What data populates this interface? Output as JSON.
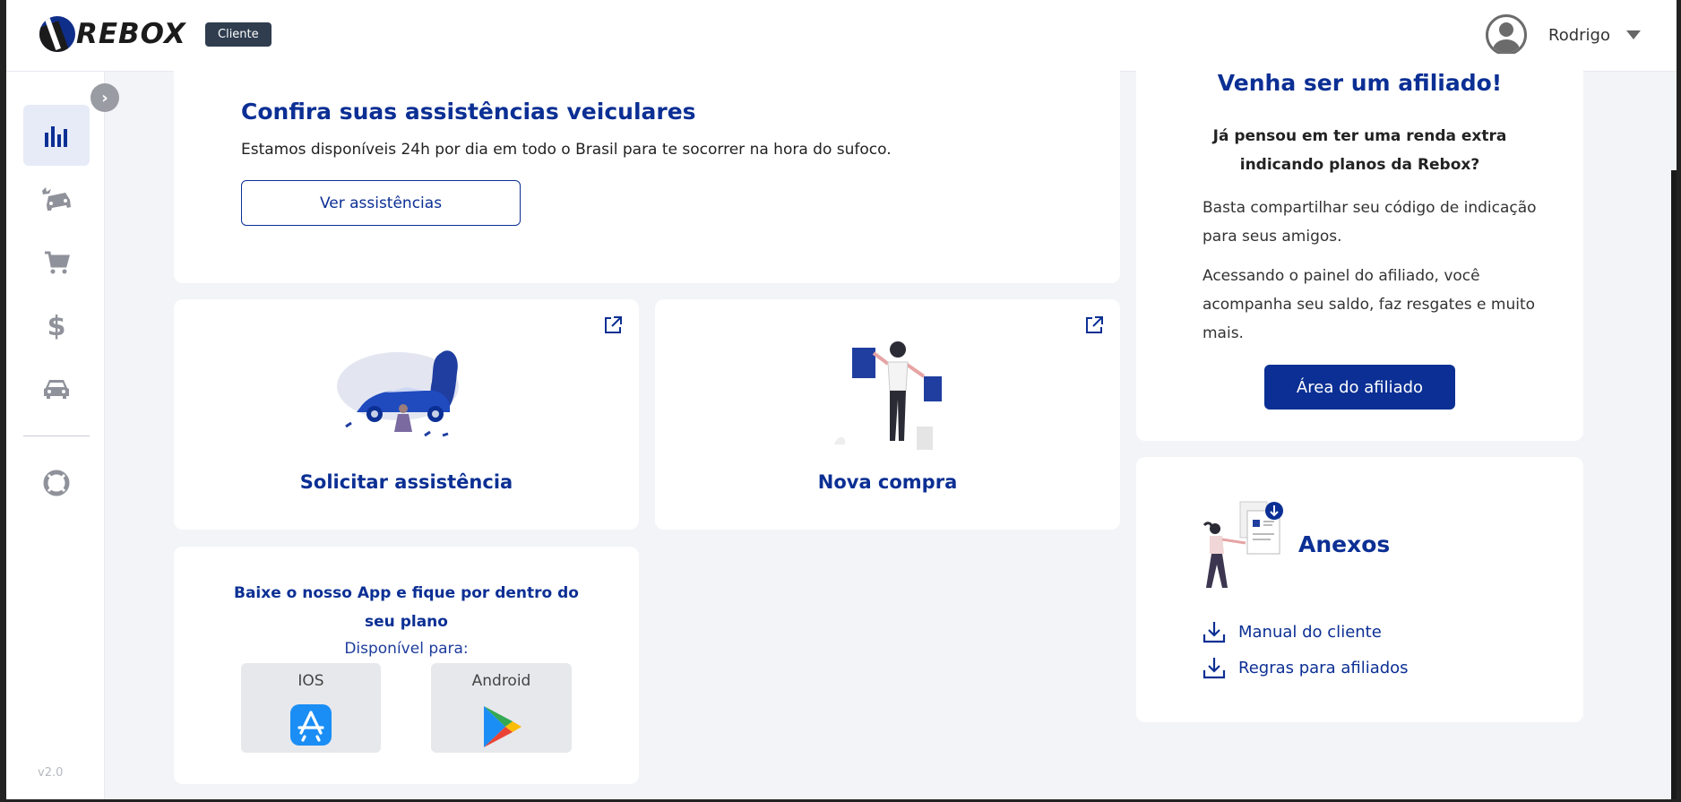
{
  "header": {
    "logo_text": "REBOX",
    "role_badge": "Cliente",
    "user_name": "Rodrigo"
  },
  "sidebar": {
    "items": [
      {
        "name": "dashboard",
        "icon": "bar-chart-icon",
        "active": true
      },
      {
        "name": "assistencias",
        "icon": "car-crash-icon",
        "active": false
      },
      {
        "name": "compras",
        "icon": "cart-icon",
        "active": false
      },
      {
        "name": "financeiro",
        "icon": "dollar-icon",
        "active": false
      },
      {
        "name": "veiculos",
        "icon": "car-icon",
        "active": false
      },
      {
        "name": "suporte",
        "icon": "lifebuoy-icon",
        "active": false
      }
    ],
    "version": "v2.0"
  },
  "assistencias": {
    "title": "Confira suas assistências veiculares",
    "subtitle": "Estamos disponíveis 24h por dia em todo o Brasil para te socorrer na hora do sufoco.",
    "button_label": "Ver assistências"
  },
  "quick_actions": {
    "solicitar_label": "Solicitar assistência",
    "compra_label": "Nova compra"
  },
  "app_download": {
    "title": "Baixe o nosso App e fique por dentro do seu plano",
    "available_label": "Disponível para:",
    "ios_label": "IOS",
    "android_label": "Android"
  },
  "afiliado": {
    "title": "Venha ser um afiliado!",
    "question": "Já pensou em ter uma renda extra indicando planos da Rebox?",
    "paragraph_1": "Basta compartilhar seu código de indicação para seus amigos.",
    "paragraph_2": "Acessando o painel do afiliado, você acompanha seu saldo, faz resgates e muito mais.",
    "button_label": "Área do afiliado"
  },
  "anexos": {
    "title": "Anexos",
    "files": [
      {
        "label": "Manual do cliente"
      },
      {
        "label": "Regras para afiliados"
      }
    ]
  },
  "colors": {
    "primary": "#0b2f94",
    "background": "#f3f4f8",
    "badge": "#2f3d4f"
  }
}
